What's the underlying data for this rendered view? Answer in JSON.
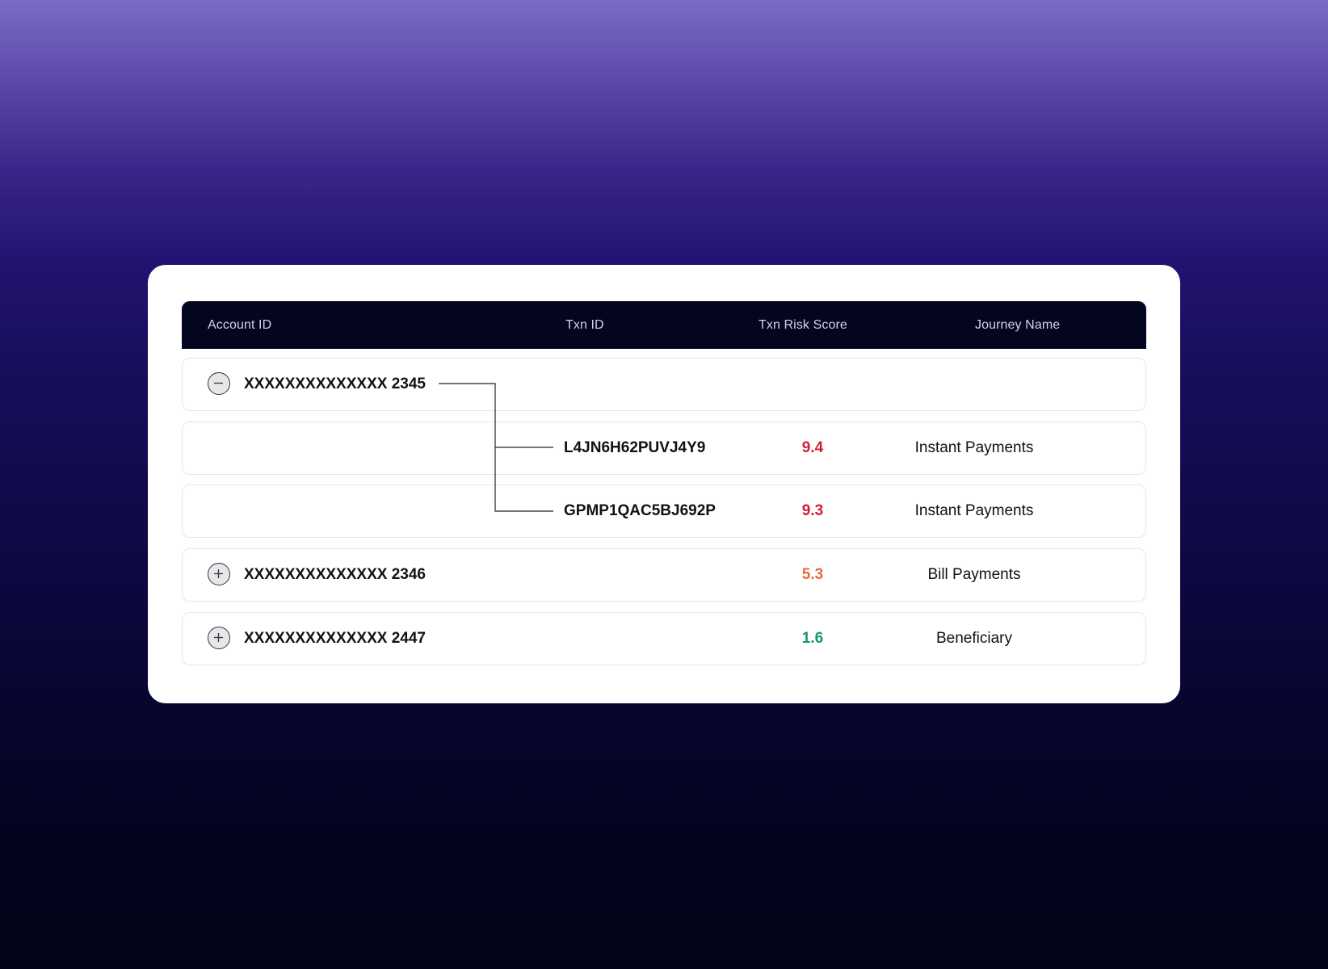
{
  "colors": {
    "header_bg": "#04051f",
    "high_risk": "#d21d3a",
    "medium_risk": "#ec6a3a",
    "low_risk": "#17995f"
  },
  "table": {
    "headers": {
      "account_id": "Account ID",
      "txn_id": "Txn ID",
      "risk_score": "Txn Risk Score",
      "journey_name": "Journey Name"
    },
    "rows": [
      {
        "account": "XXXXXXXXXXXXXX 2345",
        "toggle_icon": "minus-circle-icon",
        "expanded": true,
        "transactions": [
          {
            "txn_id": "L4JN6H62PUVJ4Y9",
            "score": "9.4",
            "journey": "Instant Payments",
            "risk_level": "high"
          },
          {
            "txn_id": "GPMP1QAC5BJ692P",
            "score": "9.3",
            "journey": "Instant Payments",
            "risk_level": "high"
          }
        ]
      },
      {
        "account": "XXXXXXXXXXXXXX 2346",
        "toggle_icon": "plus-circle-icon",
        "expanded": false,
        "score": "5.3",
        "journey": "Bill Payments",
        "risk_level": "medium"
      },
      {
        "account": "XXXXXXXXXXXXXX 2447",
        "toggle_icon": "plus-circle-icon",
        "expanded": false,
        "score": "1.6",
        "journey": "Beneficiary",
        "risk_level": "low"
      }
    ]
  }
}
